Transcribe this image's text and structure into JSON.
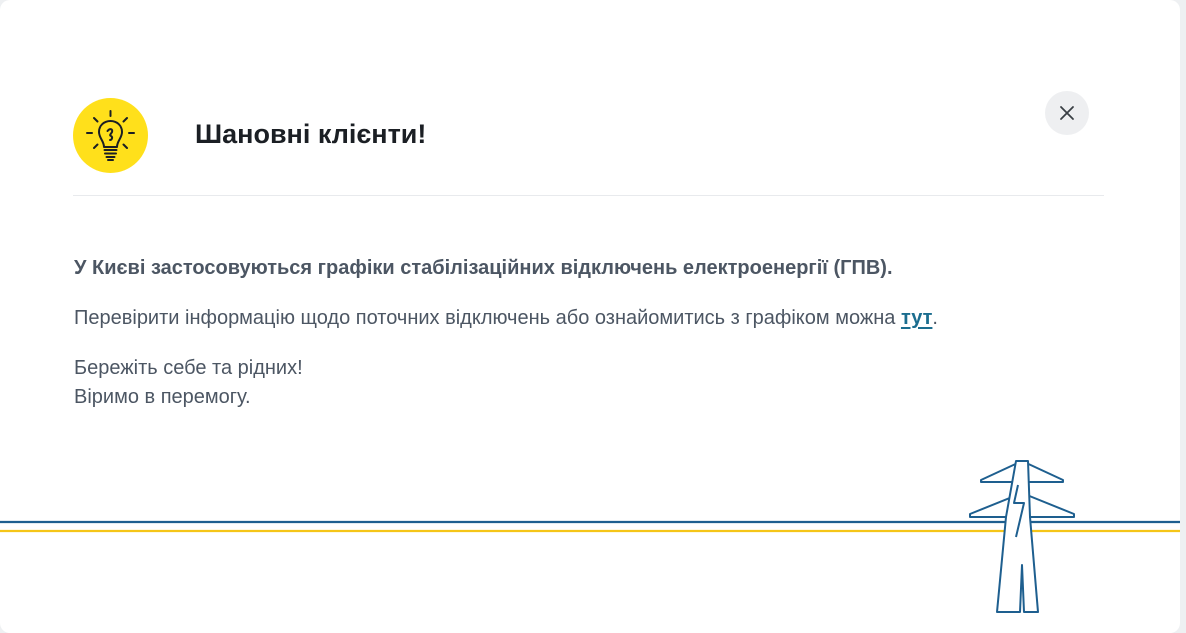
{
  "modal": {
    "title": "Шановні клієнти!",
    "lead": "У Києві застосовуються графіки стабілізаційних відключень електроенергії (ГПВ).",
    "info_text": "Перевірити інформацію щодо поточних відключень або ознайомитись з графіком можна ",
    "link_label": "тут",
    "info_end": ".",
    "farewell_line1": "Бережіть себе та рідних!",
    "farewell_line2": "Віримо в перемогу.",
    "icons": {
      "header": "lightbulb-icon",
      "close": "close-icon",
      "decoration": "power-pylon-icon"
    }
  },
  "colors": {
    "bulb_badge": "#ffe01b",
    "line_blue": "#1e5f8f",
    "line_yellow": "#f5c518",
    "link": "#1b6d8f"
  }
}
